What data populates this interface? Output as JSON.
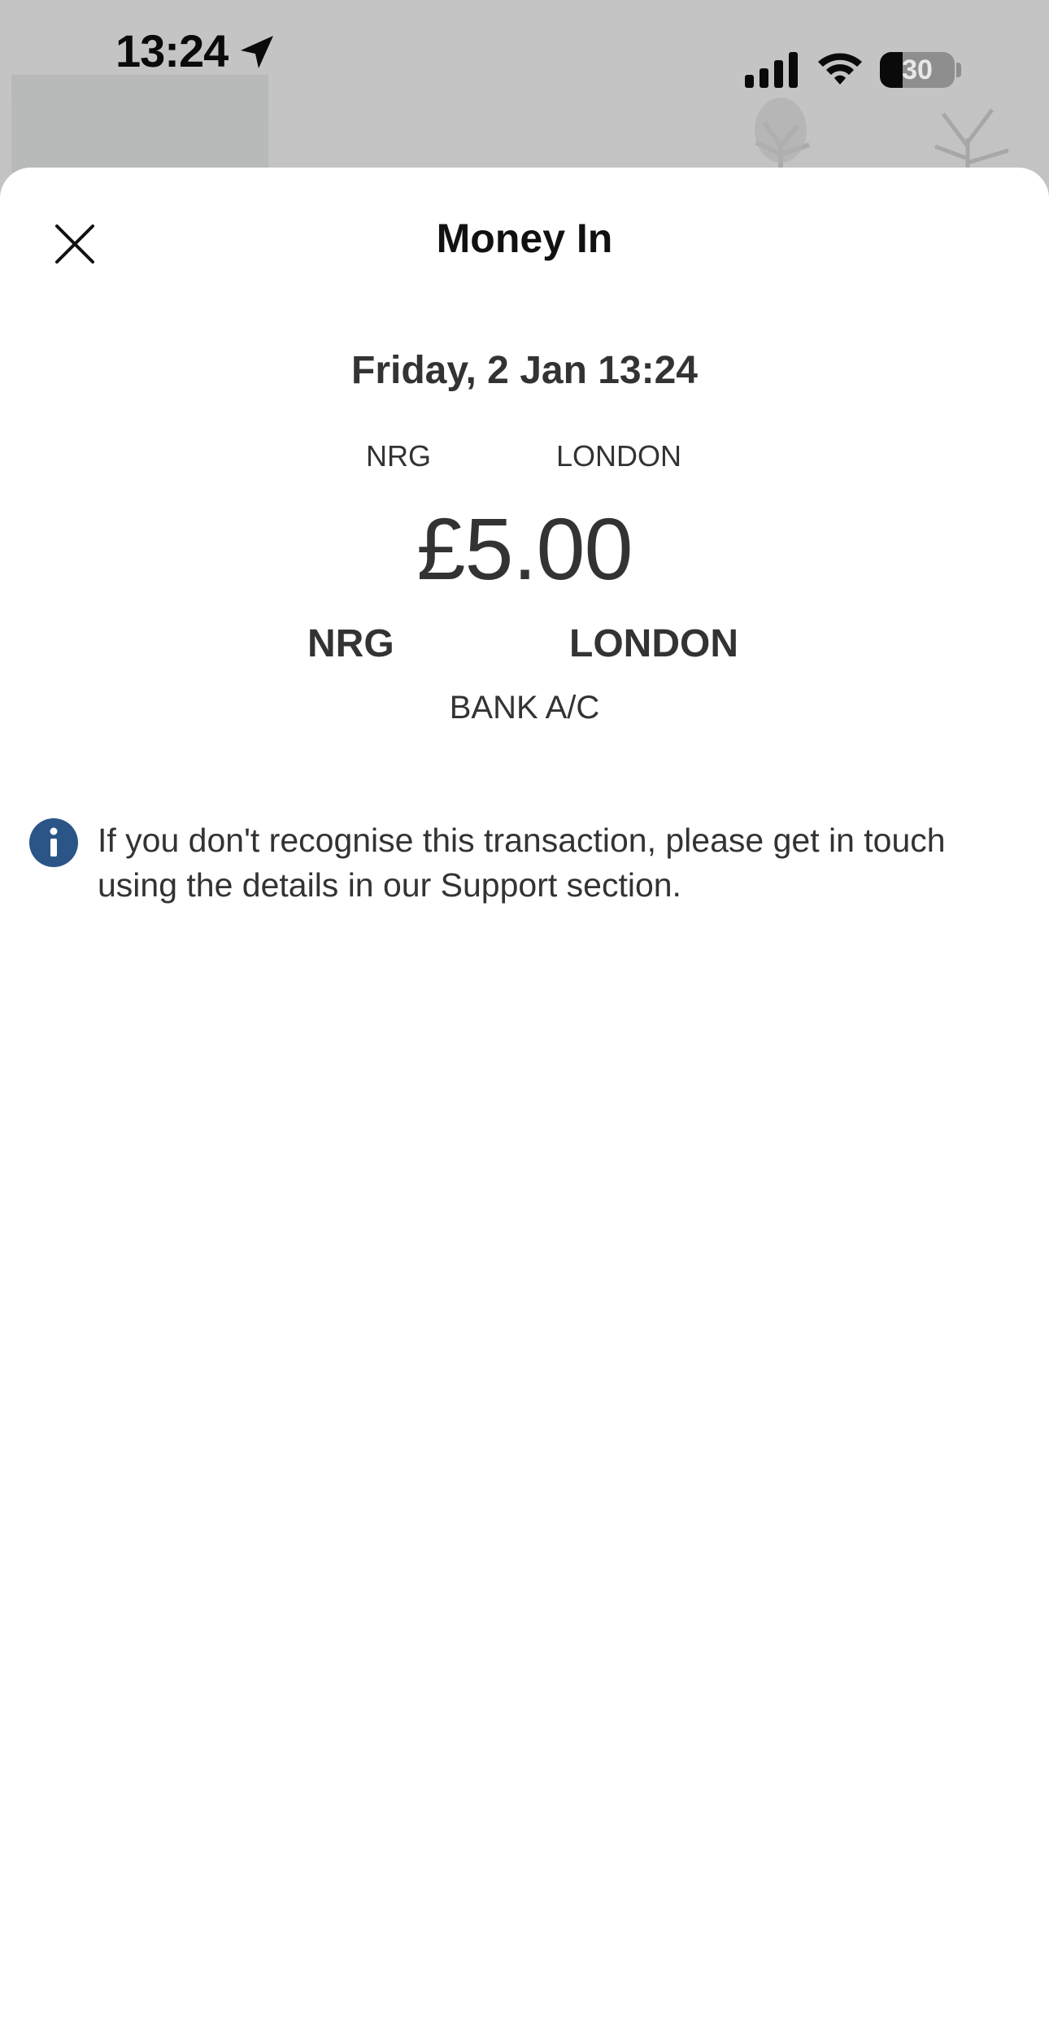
{
  "status_bar": {
    "time": "13:24",
    "battery_percent": "30",
    "battery_level": 0.3,
    "icons": [
      "location-arrow-icon",
      "cellular-signal-icon",
      "wifi-icon",
      "battery-icon"
    ]
  },
  "sheet": {
    "title": "Money In",
    "close_icon": "close-icon"
  },
  "transaction": {
    "datetime": "Friday, 2 Jan 13:24",
    "small_line": {
      "left": "NRG",
      "right": "LONDON"
    },
    "amount": "£5.00",
    "large_line": {
      "left": "NRG",
      "right": "LONDON"
    },
    "account": "BANK A/C"
  },
  "notice": {
    "icon": "info-icon",
    "icon_color": "#2b5587",
    "text": "If you don't recognise this transaction, please get in touch using the details in our Support section."
  }
}
